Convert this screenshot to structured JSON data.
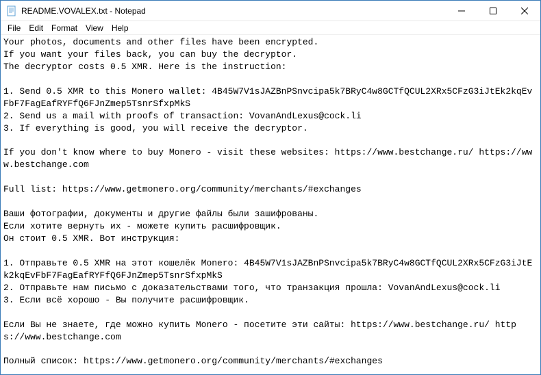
{
  "window": {
    "title": "README.VOVALEX.txt - Notepad"
  },
  "menubar": {
    "file": "File",
    "edit": "Edit",
    "format": "Format",
    "view": "View",
    "help": "Help"
  },
  "content": {
    "text": "Your photos, documents and other files have been encrypted.\nIf you want your files back, you can buy the decryptor.\nThe decryptor costs 0.5 XMR. Here is the instruction:\n\n1. Send 0.5 XMR to this Monero wallet: 4B45W7V1sJAZBnPSnvcipa5k7BRyC4w8GCTfQCUL2XRx5CFzG3iJtEk2kqEvFbF7FagEafRYFfQ6FJnZmep5TsnrSfxpMkS\n2. Send us a mail with proofs of transaction: VovanAndLexus@cock.li\n3. If everything is good, you will receive the decryptor.\n\nIf you don't know where to buy Monero - visit these websites: https://www.bestchange.ru/ https://www.bestchange.com\n\nFull list: https://www.getmonero.org/community/merchants/#exchanges\n\nВаши фотографии, документы и другие файлы были зашифрованы.\nЕсли хотите вернуть их - можете купить расшифровщик.\nОн стоит 0.5 XMR. Вот инструкция:\n\n1. Отправьте 0.5 XMR на этот кошелёк Monero: 4B45W7V1sJAZBnPSnvcipa5k7BRyC4w8GCTfQCUL2XRx5CFzG3iJtEk2kqEvFbF7FagEafRYFfQ6FJnZmep5TsnrSfxpMkS\n2. Отправьте нам письмо с доказательствами того, что транзакция прошла: VovanAndLexus@cock.li\n3. Если всё хорошо - Вы получите расшифровщик.\n\nЕсли Вы не знаете, где можно купить Monero - посетите эти сайты: https://www.bestchange.ru/ https://www.bestchange.com\n\nПолный список: https://www.getmonero.org/community/merchants/#exchanges"
  }
}
